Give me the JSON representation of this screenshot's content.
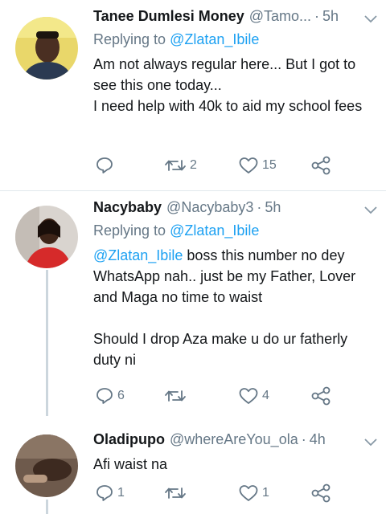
{
  "tweets": [
    {
      "display_name": "Tanee Dumlesi Money",
      "handle": "@Tamo...",
      "time": "5h",
      "replying_prefix": "Replying to ",
      "replying_to": "@Zlatan_Ibile",
      "lines": [
        "Am not always regular here... But I got to see this one today...",
        "I need help with 40k to aid my school fees"
      ],
      "reply_count": "",
      "retweet_count": "2",
      "like_count": "15"
    },
    {
      "display_name": "Nacybaby",
      "handle": "@Nacybaby3",
      "time": "5h",
      "replying_prefix": "Replying to ",
      "replying_to": "@Zlatan_Ibile",
      "body_mention": "@Zlatan_Ibile",
      "body_line1": " boss this number no dey WhatsApp nah.. just be my Father, Lover and Maga no time to waist",
      "body_line2": "Should I drop Aza make u do ur fatherly duty ni",
      "reply_count": "6",
      "retweet_count": "",
      "like_count": "4"
    },
    {
      "display_name": "Oladipupo",
      "handle": "@whereAreYou_ola",
      "time": "4h",
      "body": "Afi waist na",
      "reply_count": "1",
      "retweet_count": "",
      "like_count": "1"
    }
  ],
  "separator": "·",
  "icons": {
    "reply": "reply-icon",
    "retweet": "retweet-icon",
    "like": "heart-icon",
    "share": "share-icon",
    "more": "chevron-down-icon"
  },
  "colors": {
    "link": "#1da1f2",
    "secondary_text": "#657786",
    "divider": "#e1e8ed",
    "thread_line": "#ccd6dd"
  }
}
